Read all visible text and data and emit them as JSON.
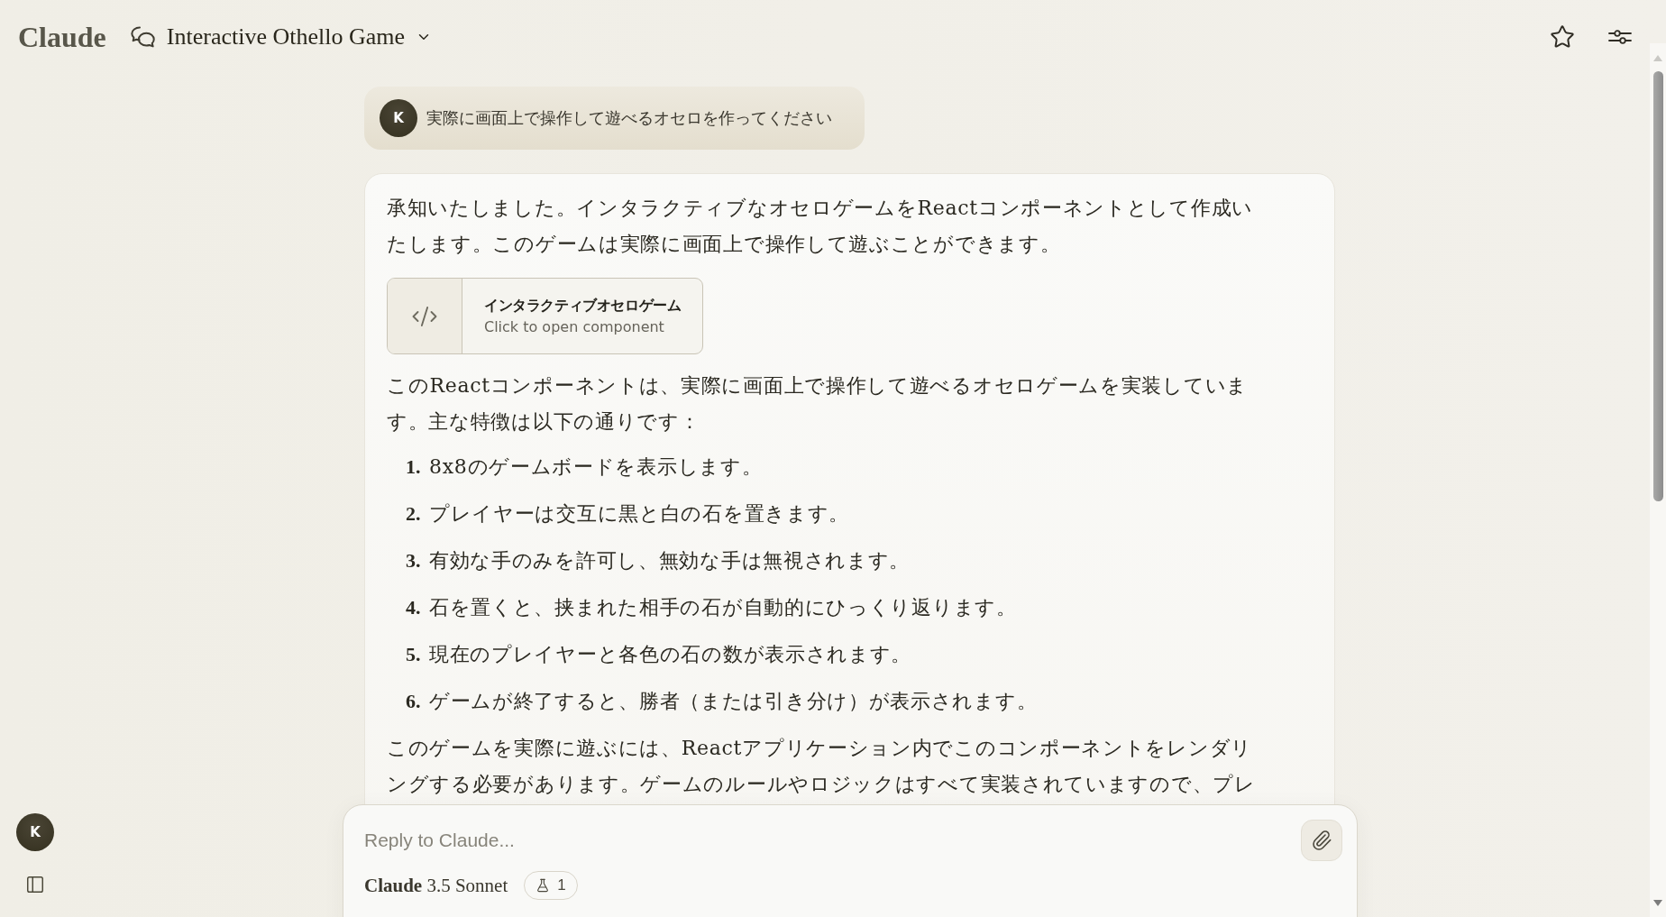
{
  "header": {
    "logo": "Claude",
    "conversation_title": "Interactive Othello Game"
  },
  "thread": {
    "user_message": {
      "avatar_initial": "K",
      "text": "実際に画面上で操作して遊べるオセロを作ってください"
    },
    "assistant_message": {
      "blocks": [
        {
          "kind": "paragraph",
          "text": "承知いたしました。インタラクティブなオセロゲームをReactコンポーネントとして作成いたします。このゲームは実際に画面上で操作して遊ぶことができます。"
        },
        {
          "kind": "artifact",
          "title": "インタラクティブオセロゲーム",
          "subtitle": "Click to open component"
        },
        {
          "kind": "paragraph",
          "text": "このReactコンポーネントは、実際に画面上で操作して遊べるオセロゲームを実装しています。主な特徴は以下の通りです："
        },
        {
          "kind": "list",
          "items": [
            {
              "number": "1.",
              "text": "8x8のゲームボードを表示します。"
            },
            {
              "number": "2.",
              "text": "プレイヤーは交互に黒と白の石を置きます。"
            },
            {
              "number": "3.",
              "text": "有効な手のみを許可し、無効な手は無視されます。"
            },
            {
              "number": "4.",
              "text": "石を置くと、挟まれた相手の石が自動的にひっくり返ります。"
            },
            {
              "number": "5.",
              "text": "現在のプレイヤーと各色の石の数が表示されます。"
            },
            {
              "number": "6.",
              "text": "ゲームが終了すると、勝者（または引き分け）が表示されます。"
            }
          ]
        },
        {
          "kind": "paragraph",
          "text": "このゲームを実際に遊ぶには、Reactアプリケーション内でこのコンポーネントをレンダリングする必要があります。ゲームのルールやロジックはすべて実装されていますので、プレ"
        }
      ]
    }
  },
  "sidebar": {
    "avatar_initial": "K"
  },
  "composer": {
    "placeholder": "Reply to Claude...",
    "model": "**Claude** 3.5 Sonnet",
    "feature_count": "1"
  }
}
